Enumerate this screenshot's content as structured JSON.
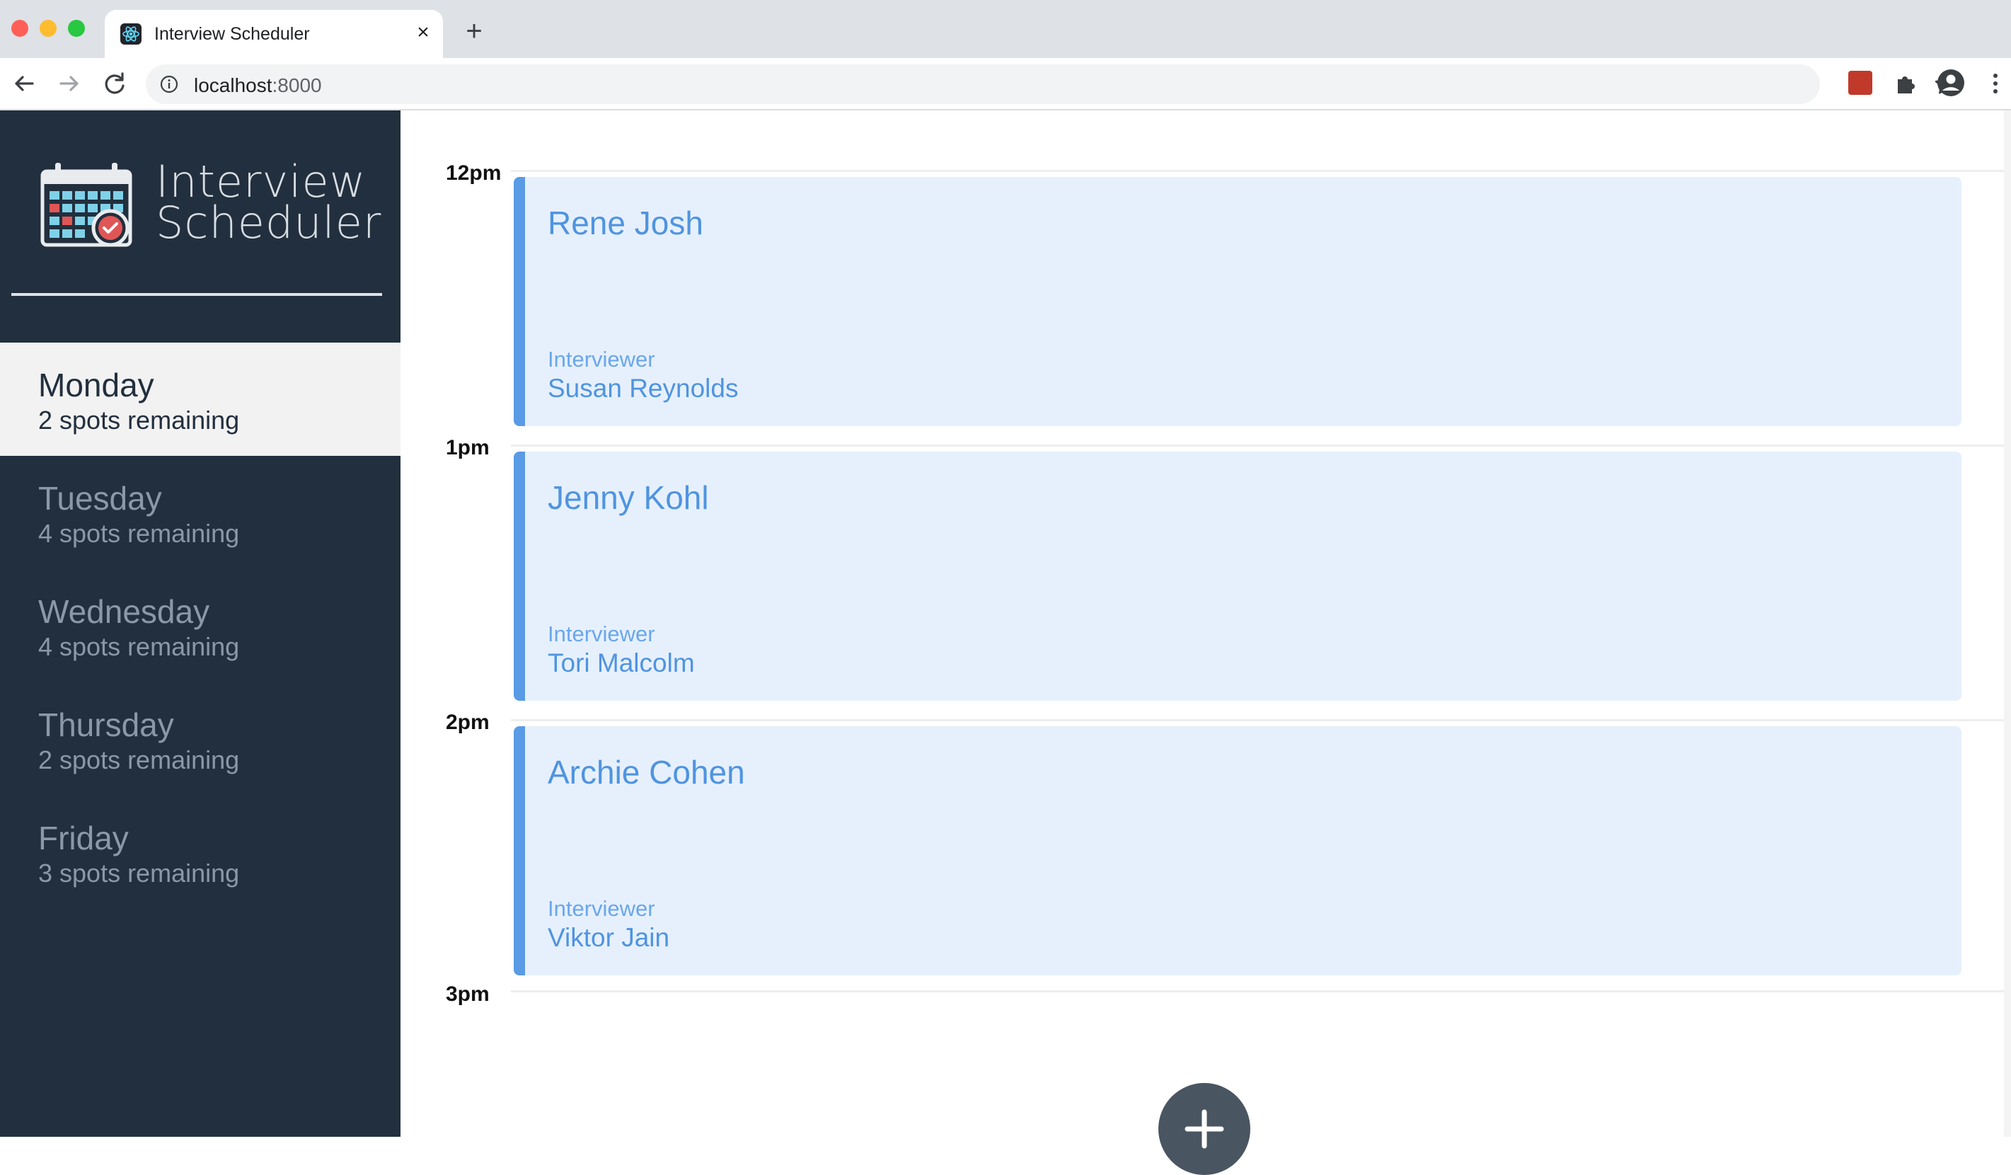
{
  "browser": {
    "tab_title": "Interview Scheduler",
    "tab_close": "×",
    "new_tab": "+",
    "url_host": "localhost",
    "url_port": ":8000"
  },
  "sidebar": {
    "brand": "Interview\nScheduler",
    "days": [
      {
        "name": "Monday",
        "spots": "2 spots remaining",
        "selected": true
      },
      {
        "name": "Tuesday",
        "spots": "4 spots remaining",
        "selected": false
      },
      {
        "name": "Wednesday",
        "spots": "4 spots remaining",
        "selected": false
      },
      {
        "name": "Thursday",
        "spots": "2 spots remaining",
        "selected": false
      },
      {
        "name": "Friday",
        "spots": "3 spots remaining",
        "selected": false
      }
    ]
  },
  "schedule": {
    "appointments": [
      {
        "time": "12pm",
        "student": "Rene Josh",
        "interviewer_label": "Interviewer",
        "interviewer": "Susan Reynolds"
      },
      {
        "time": "1pm",
        "student": "Jenny Kohl",
        "interviewer_label": "Interviewer",
        "interviewer": "Tori Malcolm"
      },
      {
        "time": "2pm",
        "student": "Archie Cohen",
        "interviewer_label": "Interviewer",
        "interviewer": "Viktor Jain"
      }
    ],
    "last_time": "3pm"
  },
  "colors": {
    "sidebar_bg": "#222f3e",
    "card_bg": "#e6f0fd",
    "card_accent": "#5a9be6",
    "selected_day_bg": "#f2f2f2"
  }
}
